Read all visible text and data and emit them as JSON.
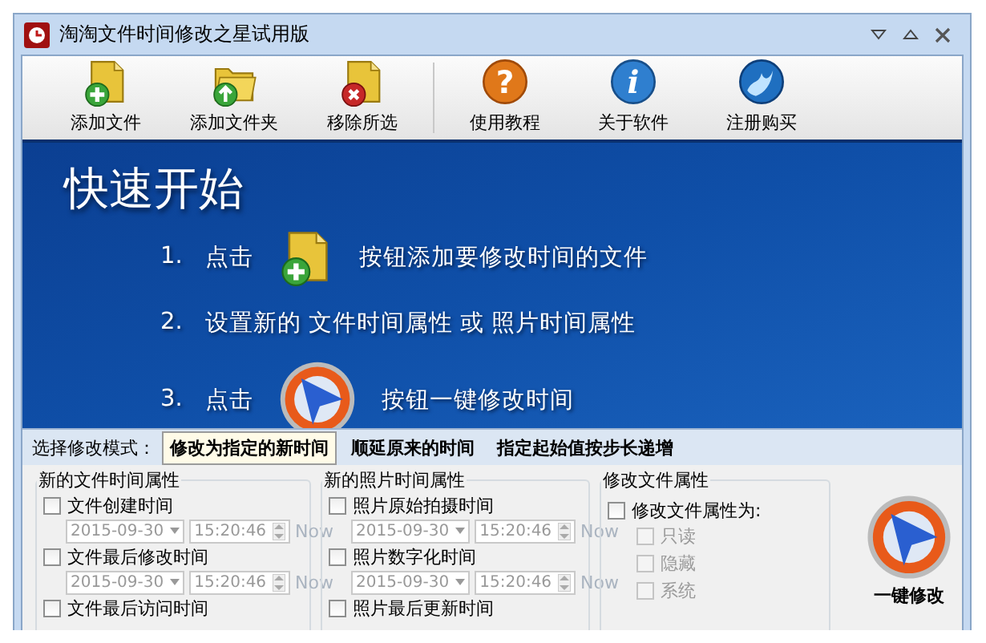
{
  "window": {
    "title": "淘淘文件时间修改之星试用版"
  },
  "toolbar": {
    "left": [
      {
        "label": "添加文件",
        "kind": "file-add"
      },
      {
        "label": "添加文件夹",
        "kind": "folder-up"
      },
      {
        "label": "移除所选",
        "kind": "file-remove"
      }
    ],
    "right": [
      {
        "label": "使用教程",
        "kind": "help",
        "glyph": "?"
      },
      {
        "label": "关于软件",
        "kind": "info",
        "glyph": "i"
      },
      {
        "label": "注册购买",
        "kind": "globe"
      }
    ]
  },
  "quick_start": {
    "title": "快速开始",
    "steps": [
      {
        "number": "1.",
        "kind": "add-file",
        "before": "点击",
        "after": "按钮添加要修改时间的文件"
      },
      {
        "number": "2.",
        "kind": "text",
        "text": "设置新的 文件时间属性 或 照片时间属性"
      },
      {
        "number": "3.",
        "kind": "modify",
        "before": "点击",
        "after": "按钮一键修改时间"
      }
    ]
  },
  "mode": {
    "label": "选择修改模式：",
    "tabs": [
      {
        "label": "修改为指定的新时间",
        "selected": true
      },
      {
        "label": "顺延原来的时间",
        "selected": false
      },
      {
        "label": "指定起始值按步长递增",
        "selected": false
      }
    ]
  },
  "file_time": {
    "title": "新的文件时间属性",
    "rows": [
      {
        "label": "文件创建时间",
        "checked": false,
        "date": "2015-09-30",
        "time": "15:20:46",
        "now": "Now"
      },
      {
        "label": "文件最后修改时间",
        "checked": false,
        "date": "2015-09-30",
        "time": "15:20:46",
        "now": "Now"
      },
      {
        "label": "文件最后访问时间",
        "checked": false
      }
    ]
  },
  "photo_time": {
    "title": "新的照片时间属性",
    "rows": [
      {
        "label": "照片原始拍摄时间",
        "checked": false,
        "date": "2015-09-30",
        "time": "15:20:46",
        "now": "Now"
      },
      {
        "label": "照片数字化时间",
        "checked": false,
        "date": "2015-09-30",
        "time": "15:20:46",
        "now": "Now"
      },
      {
        "label": "照片最后更新时间",
        "checked": false
      }
    ]
  },
  "attributes": {
    "title": "修改文件属性",
    "main": {
      "label": "修改文件属性为:",
      "checked": false
    },
    "items": [
      {
        "label": "只读",
        "checked": false
      },
      {
        "label": "隐藏",
        "checked": false
      },
      {
        "label": "系统",
        "checked": false
      }
    ]
  },
  "modify_button": {
    "label": "一键修改"
  }
}
